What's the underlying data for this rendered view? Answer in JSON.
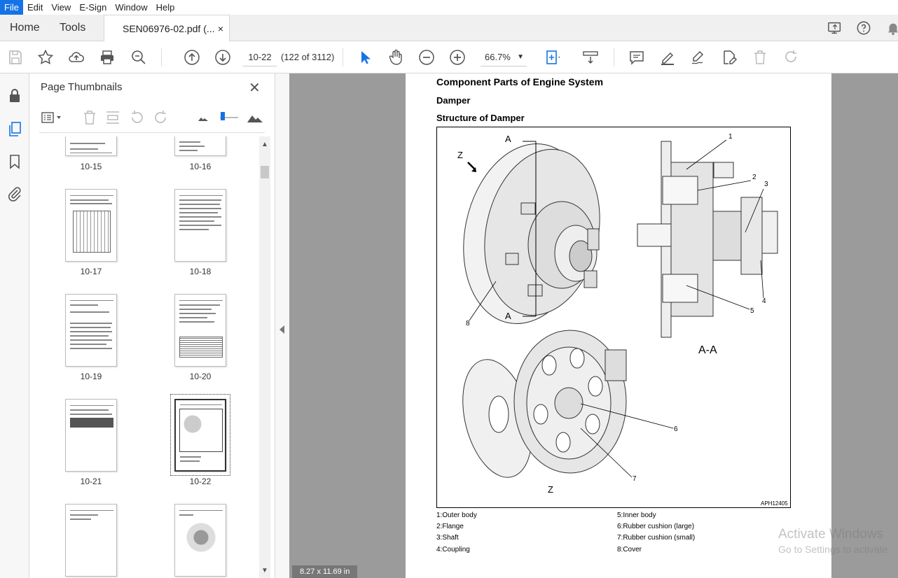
{
  "menu": {
    "items": [
      "File",
      "Edit",
      "View",
      "E-Sign",
      "Window",
      "Help"
    ]
  },
  "tabs": {
    "home": "Home",
    "tools": "Tools",
    "document": "SEN06976-02.pdf (...",
    "close": "×"
  },
  "toolbar": {
    "page_input": "10-22",
    "page_count": "(122 of 3112)",
    "zoom": "66.7%"
  },
  "panel": {
    "title": "Page Thumbnails",
    "close": "✕",
    "thumbnails": [
      {
        "label": "10-15"
      },
      {
        "label": "10-16"
      },
      {
        "label": "10-17"
      },
      {
        "label": "10-18"
      },
      {
        "label": "10-19"
      },
      {
        "label": "10-20"
      },
      {
        "label": "10-21"
      },
      {
        "label": "10-22",
        "selected": true
      },
      {
        "label": ""
      },
      {
        "label": ""
      }
    ]
  },
  "document": {
    "heading": "Component Parts of Engine System",
    "subheading": "Damper",
    "section": "Structure of Damper",
    "figure": {
      "labels": {
        "a_top": "A",
        "a_bottom": "A",
        "z_arrow": "Z",
        "z_bottom": "Z",
        "section": "A-A",
        "code": "APH12405"
      },
      "callouts": [
        "1",
        "2",
        "3",
        "4",
        "5",
        "6",
        "7",
        "8"
      ]
    },
    "legend": [
      "1:Outer body",
      "2:Flange",
      "3:Shaft",
      "4:Coupling",
      "5:Inner body",
      "6:Rubber cushion (large)",
      "7:Rubber cushion (small)",
      "8:Cover"
    ]
  },
  "status": {
    "page_size": "8.27 x 11.69 in"
  },
  "watermark": {
    "line1": "Activate Windows",
    "line2": "Go to Settings to activate"
  },
  "colors": {
    "accent": "#1473e6",
    "doc_bg": "#9b9b9b",
    "toolbar_bg": "#f0f0f0"
  }
}
